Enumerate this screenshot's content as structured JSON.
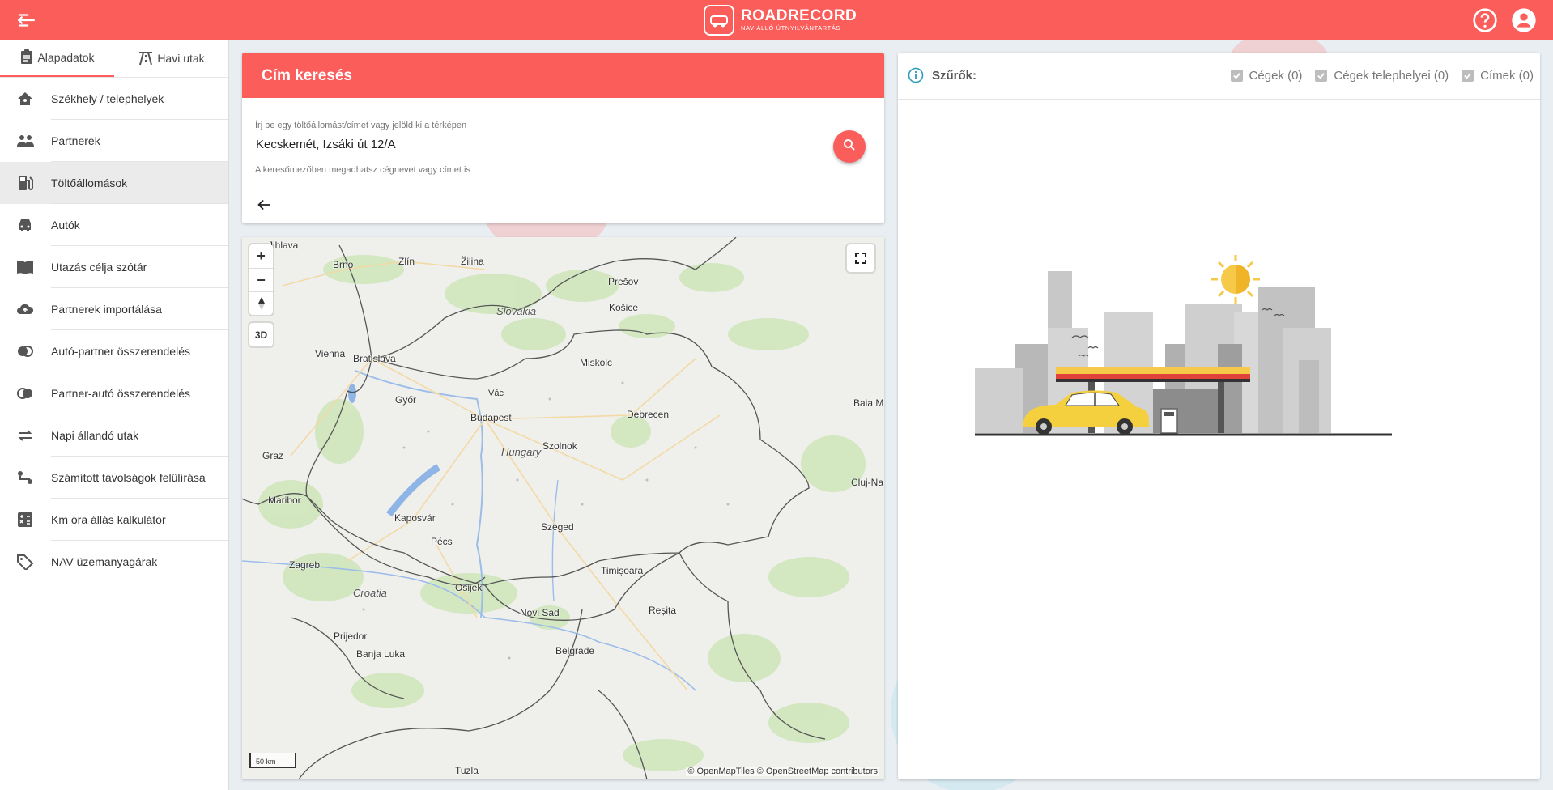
{
  "header": {
    "brand": "ROADRECORD",
    "tagline": "NAV-ÁLLÓ ÚTNYILVÁNTARTÁS",
    "icons": [
      "back-menu-icon",
      "help-icon",
      "account-icon"
    ],
    "accent": "#fb5d5b"
  },
  "sidebar": {
    "tabs": [
      {
        "label": "Alapadatok",
        "icon": "clipboard-icon",
        "active": true
      },
      {
        "label": "Havi utak",
        "icon": "road-icon",
        "active": false
      }
    ],
    "items": [
      {
        "label": "Székhely / telephelyek",
        "icon": "home-icon"
      },
      {
        "label": "Partnerek",
        "icon": "people-icon"
      },
      {
        "label": "Töltőállomások",
        "icon": "fuel-icon",
        "active": true
      },
      {
        "label": "Autók",
        "icon": "car-icon"
      },
      {
        "label": "Utazás célja szótár",
        "icon": "book-icon"
      },
      {
        "label": "Partnerek importálása",
        "icon": "upload-icon"
      },
      {
        "label": "Autó-partner összerendelés",
        "icon": "link-icon"
      },
      {
        "label": "Partner-autó összerendelés",
        "icon": "link-icon"
      },
      {
        "label": "Napi állandó utak",
        "icon": "repeat-icon"
      },
      {
        "label": "Számított távolságok felülírása",
        "icon": "route-icon"
      },
      {
        "label": "Km óra állás kalkulátor",
        "icon": "calculator-icon"
      },
      {
        "label": "NAV üzemanyagárak",
        "icon": "tag-icon"
      }
    ]
  },
  "search": {
    "title": "Cím keresés",
    "field_label": "Írj be egy töltőállomást/címet vagy jelöld ki a térképen",
    "value": "Kecskemét, Izsáki út 12/A",
    "hint": "A keresőmezőben megadhatsz cégnevet vagy címet is"
  },
  "map": {
    "zoom_in": "+",
    "zoom_out": "−",
    "btn_3d": "3D",
    "scale": "50 km",
    "attribution": "© OpenMapTiles © OpenStreetMap contributors",
    "cities": [
      "Jihlava",
      "Brno",
      "Zlín",
      "Žilina",
      "Prešov",
      "Košice",
      "Vienna",
      "Bratislava",
      "Miskolc",
      "Győr",
      "Vác",
      "Budapest",
      "Debrecen",
      "Baia M",
      "Graz",
      "Szolnok",
      "Cluj-Na",
      "Maribor",
      "Kaposvár",
      "Szeged",
      "Pécs",
      "Zagreb",
      "Timișoara",
      "Osijek",
      "Novi Sad",
      "Reșița",
      "Prijedor",
      "Banja Luka",
      "Belgrade",
      "Tuzla"
    ],
    "countries": [
      "Slovakia",
      "Hungary",
      "Croatia"
    ]
  },
  "filters": {
    "title": "Szűrők:",
    "items": [
      {
        "label": "Cégek (0)",
        "checked": true
      },
      {
        "label": "Cégek telephelyei (0)",
        "checked": true
      },
      {
        "label": "Címek (0)",
        "checked": true
      }
    ]
  }
}
